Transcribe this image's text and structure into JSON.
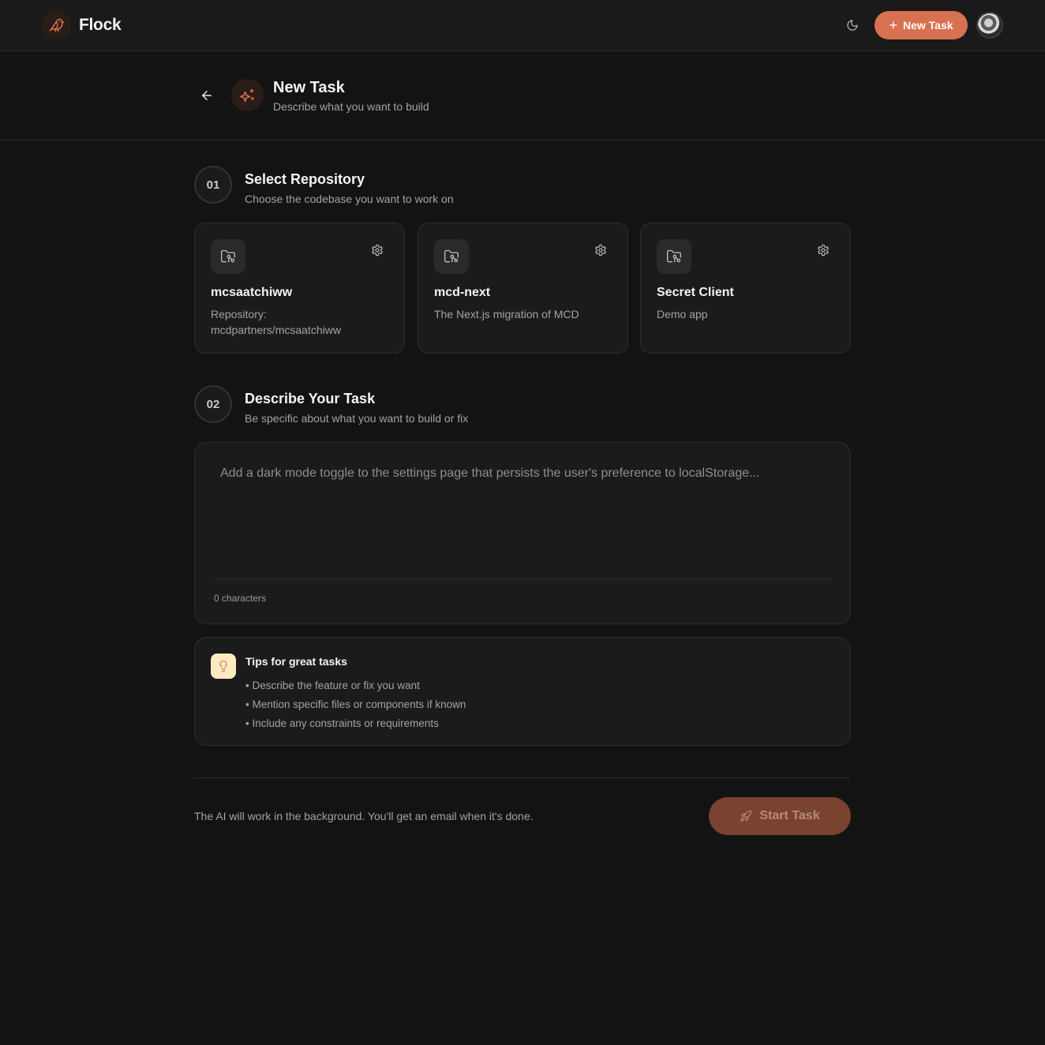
{
  "app": {
    "name": "Flock"
  },
  "topbar": {
    "new_task_label": "New Task"
  },
  "page": {
    "title": "New Task",
    "subtitle": "Describe what you want to build"
  },
  "steps": [
    {
      "number": "01",
      "title": "Select Repository",
      "subtitle": "Choose the codebase you want to work on"
    },
    {
      "number": "02",
      "title": "Describe Your Task",
      "subtitle": "Be specific about what you want to build or fix"
    }
  ],
  "repos": [
    {
      "name": "mcsaatchiww",
      "description": "Repository: mcdpartners/mcsaatchiww"
    },
    {
      "name": "mcd-next",
      "description": "The Next.js migration of MCD"
    },
    {
      "name": "Secret Client",
      "description": "Demo app"
    }
  ],
  "task": {
    "placeholder": "Add a dark mode toggle to the settings page that persists the user's preference to localStorage...",
    "value": "",
    "char_count": "0 characters"
  },
  "tips": {
    "title": "Tips for great tasks",
    "items": [
      "• Describe the feature or fix you want",
      "• Mention specific files or components if known",
      "• Include any constraints or requirements"
    ]
  },
  "footer": {
    "note": "The AI will work in the background. You'll get an email when it's done.",
    "start_label": "Start Task"
  },
  "icons": {
    "logo": "bird-icon",
    "theme": "moon-icon",
    "back": "arrow-left-icon",
    "header": "sparkles-icon",
    "repo": "folder-git-icon",
    "settings": "gear-icon",
    "tips": "lightbulb-icon",
    "start": "rocket-icon"
  },
  "colors": {
    "accent": "#d8714f",
    "accent_disabled": "#7a4231",
    "background": "#131313",
    "surface": "#1b1b1b",
    "tips_icon_bg": "#fdebc0"
  }
}
